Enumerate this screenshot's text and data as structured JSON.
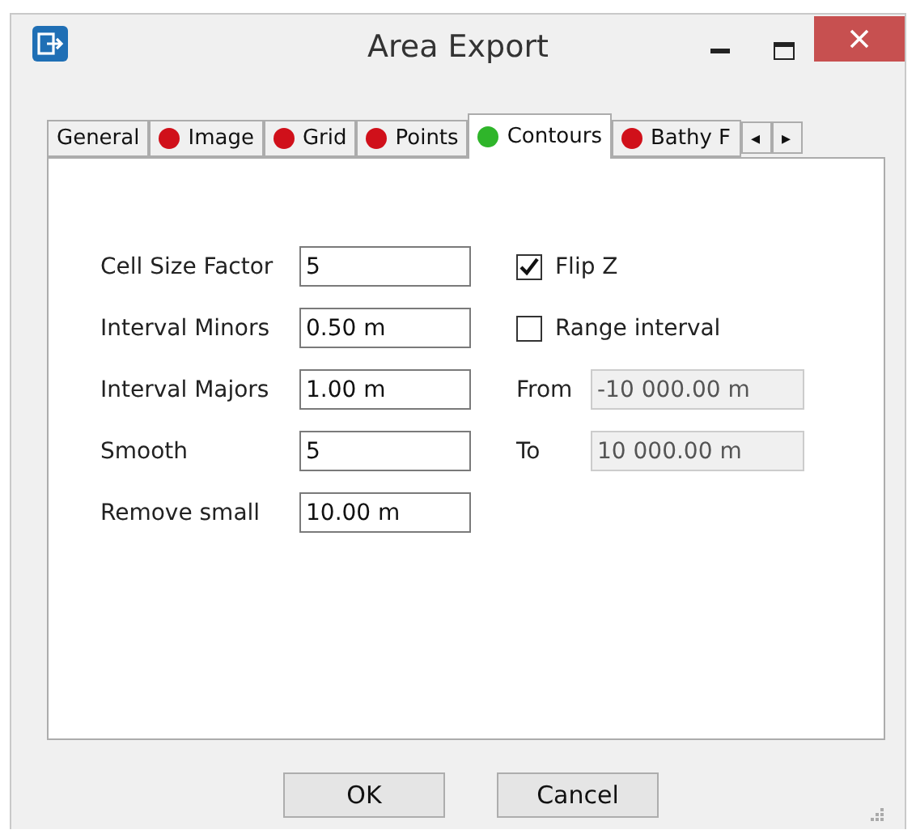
{
  "window": {
    "title": "Area Export"
  },
  "tabs": [
    {
      "label": "General",
      "selected": false
    },
    {
      "label": "Image",
      "selected": false,
      "color": "#d0101a"
    },
    {
      "label": "Grid",
      "selected": false,
      "color": "#d0101a"
    },
    {
      "label": "Points",
      "selected": false,
      "color": "#d0101a"
    },
    {
      "label": "Contours",
      "selected": true,
      "color": "#2fb52a"
    },
    {
      "label": "Bathy F",
      "selected": false,
      "color": "#d0101a"
    }
  ],
  "tab_scroll": {
    "left": "◂",
    "right": "▸"
  },
  "fields": [
    {
      "label": "Cell Size Factor",
      "value": "5"
    },
    {
      "label": "Interval Minors",
      "value": "0.50 m"
    },
    {
      "label": "Interval Majors",
      "value": "1.00 m"
    },
    {
      "label": "Smooth",
      "value": "5"
    },
    {
      "label": "Remove small",
      "value": "10.00 m"
    }
  ],
  "options": [
    {
      "kind": "checkbox",
      "label": "Flip Z",
      "checked": true
    },
    {
      "kind": "checkbox",
      "label": "Range interval",
      "checked": false
    },
    {
      "kind": "field",
      "label": "From",
      "value": "-10 000.00 m",
      "disabled": true
    },
    {
      "kind": "field",
      "label": "To",
      "value": "10 000.00 m",
      "disabled": true
    }
  ],
  "buttons": [
    "OK",
    "Cancel"
  ]
}
